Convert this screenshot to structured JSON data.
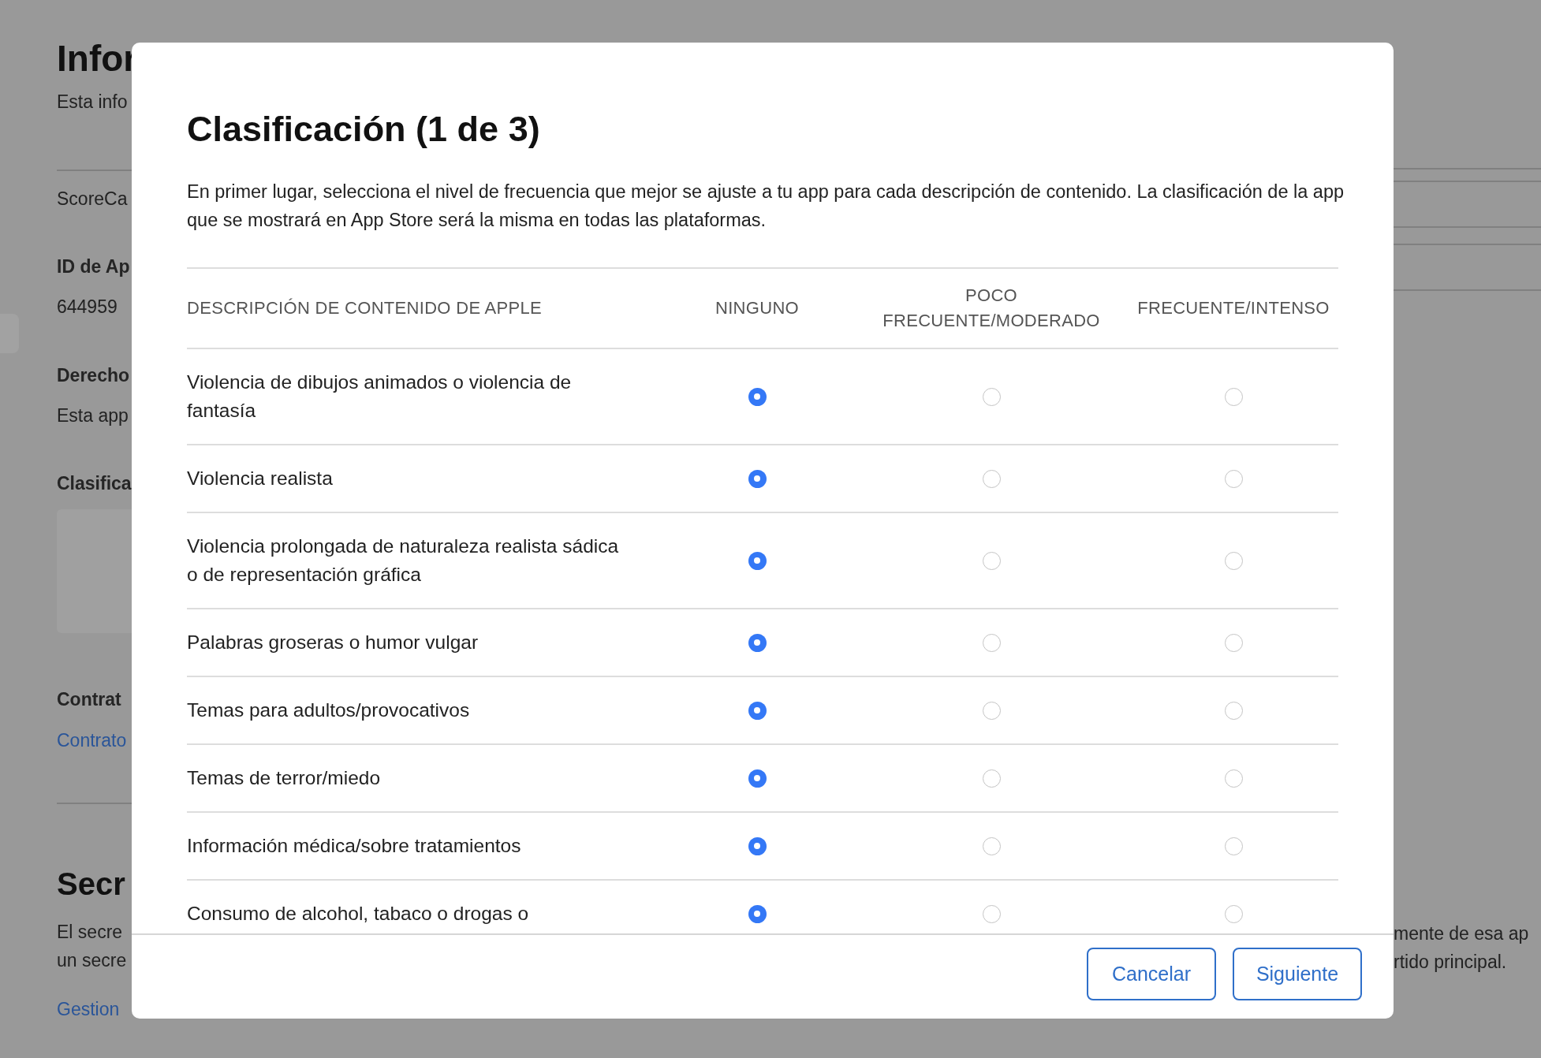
{
  "background": {
    "title": "Infor",
    "subtitle": "Esta info",
    "app_name": "ScoreCa",
    "fields": [
      {
        "label": "ID de Ap",
        "value": "644959"
      },
      {
        "label": "Derecho",
        "value": "Esta app"
      }
    ],
    "rating_label": "Clasifica",
    "contract_label": "Contrat",
    "contract_link": "Contrato",
    "section_title": "Secr",
    "section_text": [
      "El secre",
      "un secre"
    ],
    "section_link": "Gestion",
    "right_text": [
      "mente de esa ap",
      "rtido principal."
    ]
  },
  "dialog": {
    "title": "Clasificación (1 de 3)",
    "description": "En primer lugar, selecciona el nivel de frecuencia que mejor se ajuste a tu app para cada descripción de contenido. La clasificación de la app que se mostrará en App Store será la misma en todas las plataformas.",
    "columns": [
      "DESCRIPCIÓN DE CONTENIDO DE APPLE",
      "NINGUNO",
      "POCO FRECUENTE/MODERADO",
      "FRECUENTE/INTENSO"
    ],
    "rows": [
      {
        "label": "Violencia de dibujos animados o violencia de fantasía",
        "options": [
          {
            "selected": true
          },
          {
            "selected": false
          },
          {
            "selected": false
          }
        ]
      },
      {
        "label": "Violencia realista",
        "options": [
          {
            "selected": true
          },
          {
            "selected": false
          },
          {
            "selected": false
          }
        ]
      },
      {
        "label": "Violencia prolongada de naturaleza realista sádica o de representación gráfica",
        "options": [
          {
            "selected": true
          },
          {
            "selected": false
          },
          {
            "selected": false
          }
        ]
      },
      {
        "label": "Palabras groseras o humor vulgar",
        "options": [
          {
            "selected": true
          },
          {
            "selected": false
          },
          {
            "selected": false
          }
        ]
      },
      {
        "label": "Temas para adultos/provocativos",
        "options": [
          {
            "selected": true
          },
          {
            "selected": false
          },
          {
            "selected": false
          }
        ]
      },
      {
        "label": "Temas de terror/miedo",
        "options": [
          {
            "selected": true
          },
          {
            "selected": false
          },
          {
            "selected": false
          }
        ]
      },
      {
        "label": "Información médica/sobre tratamientos",
        "options": [
          {
            "selected": true
          },
          {
            "selected": false
          },
          {
            "selected": false
          }
        ]
      },
      {
        "label": "Consumo de alcohol, tabaco o drogas o",
        "options": [
          {
            "selected": true
          },
          {
            "selected": false
          },
          {
            "selected": false
          }
        ]
      }
    ],
    "buttons": [
      "Cancelar",
      "Siguiente"
    ]
  }
}
